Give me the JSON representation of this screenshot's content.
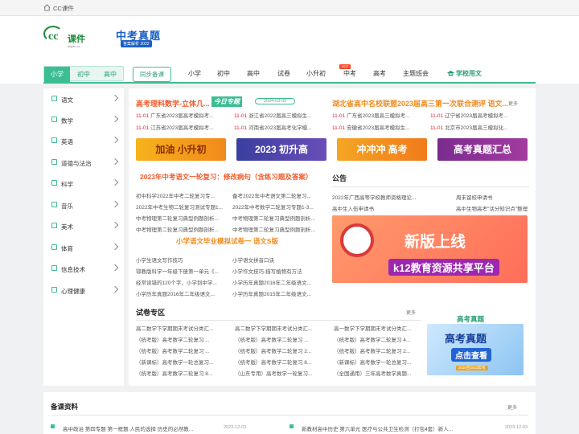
{
  "topbar": {
    "title": "CC课件"
  },
  "logo": {
    "cc": "cc",
    "name": "课件",
    "url": "kejian.cc"
  },
  "banner_ad": {
    "title": "中考真题",
    "sub": "答案解析 2022"
  },
  "nav": {
    "stages": [
      "小学",
      "初中",
      "高中"
    ],
    "tongbu": "同步备课",
    "items": [
      "小学",
      "初中",
      "高中",
      "试卷",
      "小升初",
      "中考",
      "高考",
      "主题班会"
    ],
    "hot": "HOT",
    "school": "学校用文"
  },
  "sidebar": [
    "语文",
    "数学",
    "英语",
    "道德与法治",
    "科学",
    "音乐",
    "美术",
    "体育",
    "信息技术",
    "心理健康"
  ],
  "headline1": {
    "title": "高考理科数学-立体几...",
    "tag": "今日专题",
    "date": "2024-03-05"
  },
  "headline2": {
    "title": "湖北省高中名校联盟2023届高三第一次联合测评 语文...",
    "more": "更多"
  },
  "news_left": [
    {
      "d": "11-01",
      "t": "广东省2023届高考模拟考..."
    },
    {
      "d": "11-01",
      "t": "浙江省2022届高三模拟生..."
    },
    {
      "d": "11-01",
      "t": "江苏省2023届高考模拟考..."
    },
    {
      "d": "11-01",
      "t": "河南省2023届高考化学模..."
    }
  ],
  "news_right": [
    {
      "d": "11-01",
      "t": "广东省2023届高三模拟考..."
    },
    {
      "d": "11-01",
      "t": "辽宁省2023届高考模拟考..."
    },
    {
      "d": "11-01",
      "t": "安徽省2023届高考模拟生..."
    },
    {
      "d": "11-01",
      "t": "北京市2023届高三模拟化..."
    }
  ],
  "banners": [
    "加油 小升初",
    "2023 初升高",
    "冲冲冲 高考",
    "高考真题汇总"
  ],
  "review": {
    "title": "2023年中考语文一轮复习：修改病句（含练习题及答案）",
    "rows": [
      [
        "初中科学2022年中考二轮复习专...",
        "备考2022年中考语文第二轮复习..."
      ],
      [
        "2022年中考生物二轮复习测试专题1...",
        "2022年中考数学二轮复习专题1-3..."
      ],
      [
        "中考物理第二轮复习典型例题剖析...",
        "中考物理第二轮复习典型例题剖析..."
      ],
      [
        "中考物理第二轮复习典型例题剖析...",
        "中考物理第二轮复习典型例题剖析..."
      ]
    ]
  },
  "primary": {
    "title": "小学语文毕业模拟试卷一 语文S版",
    "rows": [
      [
        "小学生语文写作技巧",
        "小学语文拼音口诀"
      ],
      [
        "鄂教版科学一年级下册第一单元《...",
        "小学作文技巧-描写植物有方法"
      ],
      [
        "经常读错的120个字，小学到中学...",
        "小学历年真题2016年二年级语文..."
      ],
      [
        "小学历年真题2016年二年级语文...",
        "小学历年真题2015年二年级语文..."
      ]
    ]
  },
  "notice": {
    "title": "公告",
    "items": [
      [
        "2022年广西高等学校教师资格理论...",
        "周末留校申请书"
      ],
      [
        "高中生入伍申请书",
        "高中生物高考\"话分知识点\"整理"
      ]
    ]
  },
  "platform": {
    "line1": "新版上线",
    "line2": "k12教育资源共享平台"
  },
  "exam": {
    "title": "试卷专区",
    "more": "更多",
    "rows": [
      [
        "高二数学下学期期末考试分类汇...",
        "高二数学下学期期末考试分类汇...",
        "高一数学下学期期末考试分类汇..."
      ],
      [
        "（统考版）高考数学二轮复习 ...",
        "（统考版）高考数学二轮复习 ...",
        "（统考版）高考数学二轮复习 4..."
      ],
      [
        "（统考版）高考数学二轮复习 ...",
        "（统考版）高考数学二轮复习 2...",
        "（统考版）高考数学二轮复习 2..."
      ],
      [
        "（新课标）高考数学一轮总复习...",
        "（统考版）高考数学二轮复习 8...",
        "（新课标）高考数学一轮总复习..."
      ],
      [
        "（统考版）高考数学二轮复习 8...",
        "（山东专用）高考数学一轮复习...",
        "（全国通用）三年高考数学真题..."
      ]
    ]
  },
  "gkzt": {
    "title": "高考真题",
    "b1": "高考真题",
    "b2": "点击查看",
    "b3": "2016至2023年考"
  },
  "bottom": {
    "title": "备课资料",
    "more": "更多",
    "items": [
      {
        "t": "高中政治 第四专题 第一框题 人民的选择 历史的必然教...",
        "d": "2023-12-03"
      },
      {
        "t": "新教材高中历史 第六单元 医疗与公共卫生检测（打包4套）新人...",
        "d": "2023-12-03"
      }
    ]
  }
}
